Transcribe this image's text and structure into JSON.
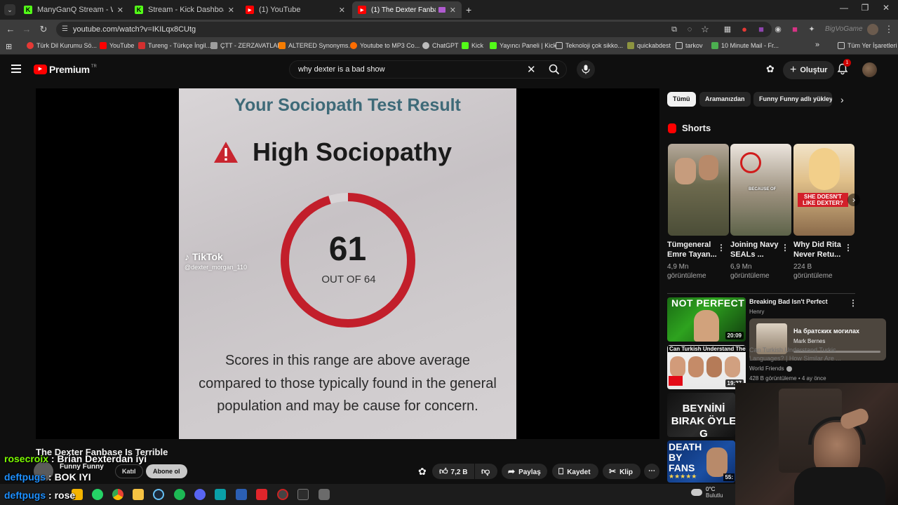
{
  "tabs": [
    {
      "title": "ManyGanQ Stream - Watch Live",
      "color": "#53fc18",
      "glyph": "K"
    },
    {
      "title": "Stream - Kick Dashboard",
      "color": "#53fc18",
      "glyph": "K"
    },
    {
      "title": "(1) YouTube",
      "color": "#ff0000",
      "glyph": "▶"
    },
    {
      "title": "(1) The Dexter Fanbase Is Terrible",
      "color": "#ff0000",
      "glyph": "▶"
    }
  ],
  "address": {
    "url": "youtube.com/watch?v=IKILqx8CUtg"
  },
  "extension_overlay": "BigVoGame",
  "bookmarks": [
    {
      "label": "Türk Dil Kurumu Sö...",
      "color": "#e53935"
    },
    {
      "label": "YouTube",
      "color": "#ff0000"
    },
    {
      "label": "Tureng - Türkçe İngil...",
      "color": "#d32f2f"
    },
    {
      "label": "ÇTT - ZERZAVATLAR",
      "color": "#9e9e9e"
    },
    {
      "label": "ALTERED Synonyms...",
      "color": "#f57c00"
    },
    {
      "label": "Youtube to MP3 Co...",
      "color": "#ff6d00"
    },
    {
      "label": "ChatGPT",
      "color": "#bdbdbd"
    },
    {
      "label": "Kick",
      "color": "#53fc18"
    },
    {
      "label": "Yayıncı Paneli | Kick",
      "color": "#53fc18"
    },
    {
      "label": "Teknoloji çok sikko...",
      "color": "#757575"
    },
    {
      "label": "quickabdest",
      "color": "#8d9440"
    },
    {
      "label": "tarkov",
      "color": "#757575"
    },
    {
      "label": "10 Minute Mail - Fr...",
      "color": "#4caf50"
    }
  ],
  "bookmarks_overflow": "»",
  "all_bookmarks": "Tüm Yer İşaretleri",
  "youtube": {
    "logo": "Premium",
    "logo_region": "TR",
    "search_value": "why dexter is a bad show",
    "create_label": "Oluştur",
    "notif_count": "1"
  },
  "video_frame": {
    "heading": "Your Sociopath Test Result",
    "result": "High Sociopathy",
    "score": "61",
    "out_of": "OUT OF 64",
    "score_fraction": 0.953,
    "watermark": "TikTok",
    "watermark_user": "@dexter_morgan_110",
    "body": "Scores in this range are above average compared to those typically found in the general population and may be cause for concern."
  },
  "video": {
    "title": "The Dexter Fanbase Is Terrible",
    "channel": "Funny Funny",
    "join_label": "Katıl",
    "subscribe_label": "Abone ol",
    "likes": "7,2 B",
    "share_label": "Paylaş",
    "save_label": "Kaydet",
    "clip_label": "Klip"
  },
  "chips": [
    "Tümü",
    "Aramanızdan",
    "Funny Funny adlı yükley"
  ],
  "shorts": {
    "heading": "Shorts",
    "items": [
      {
        "title": "Tümgeneral Emre Tayan...",
        "views": "4,9 Mn görüntüleme"
      },
      {
        "title": "Joining Navy SEALs ...",
        "views": "6,9 Mn görüntüleme",
        "overlay": "BECAUSE OF"
      },
      {
        "title": "Why Did Rita Never Retu...",
        "views": "224 B görüntüleme",
        "overlay": "SHE DOESN'T LIKE DEXTER?"
      }
    ]
  },
  "recommendations": [
    {
      "thumb_text": "NOT PERFECT",
      "duration": "20:09",
      "title": "Breaking Bad Isn't Perfect",
      "channel": "Henry"
    },
    {
      "thumb_text": "Can Turkish Understand Them?",
      "duration": "19:27",
      "title": "Can Turkish Understand Turkic Languages? | How Similar Are ...",
      "channel": "World Friends",
      "meta": "428 B görüntüleme • 4 ay önce"
    },
    {
      "thumb_text": "BEYNİNİ BIRAK ÖYLE G",
      "duration": "",
      "title": "",
      "channel": ""
    },
    {
      "thumb_text": "DEATH BY FANS",
      "duration": "55:",
      "title": "",
      "channel": ""
    }
  ],
  "music_popup": {
    "title": "На братских могилах",
    "artist": "Mark Bernes"
  },
  "chat": [
    {
      "user": "rosecroix",
      "message": "Brian Dexterdan iyi",
      "color": "#7cfc00"
    },
    {
      "user": "deftpugs",
      "message": "BOK IYI",
      "color": "#1e90ff"
    },
    {
      "user": "deftpugs",
      "message": "rose",
      "color": "#1e90ff"
    }
  ],
  "weather": {
    "temp": "0°C",
    "condition": "Bulutlu"
  }
}
